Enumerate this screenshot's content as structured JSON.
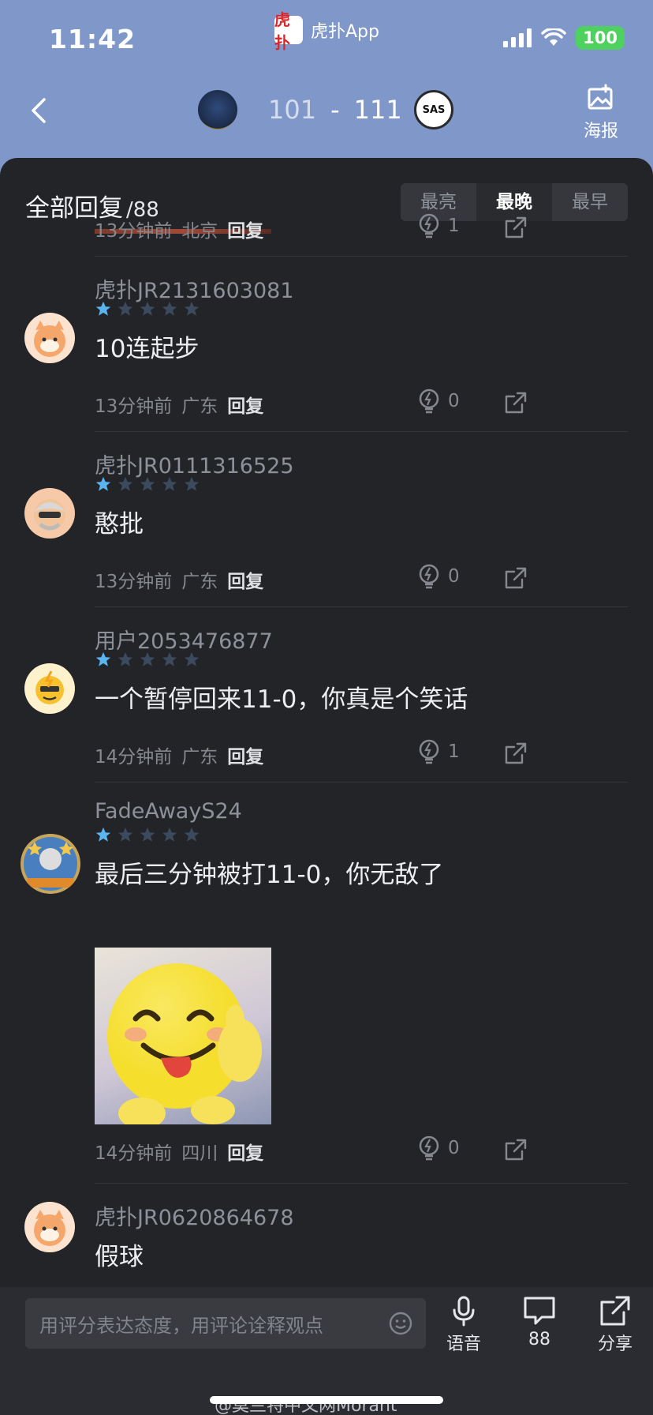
{
  "status_bar": {
    "time": "11:42",
    "app_name": "虎扑App",
    "app_logo_text": "虎扑",
    "battery": "100"
  },
  "game": {
    "home_score": "101",
    "separator": "-",
    "away_score": "111",
    "away_logo_text": "SAS",
    "poster_label": "海报"
  },
  "replies": {
    "title": "全部回复",
    "count": "/88",
    "sort_tabs": [
      "最亮",
      "最晚",
      "最早"
    ],
    "active_sort": "最晚"
  },
  "partial_comment": {
    "time": "13分钟前",
    "location": "北京",
    "reply_label": "回复",
    "lights": "1"
  },
  "comments": [
    {
      "user": "虎扑JR2131603081",
      "rating": 1,
      "content": "10连起步",
      "time": "13分钟前",
      "location": "广东",
      "reply_label": "回复",
      "lights": "0"
    },
    {
      "user": "虎扑JR0111316525",
      "rating": 1,
      "content": "憨批",
      "time": "13分钟前",
      "location": "广东",
      "reply_label": "回复",
      "lights": "0"
    },
    {
      "user": "用户2053476877",
      "rating": 1,
      "content": "一个暂停回来11-0，你真是个笑话",
      "time": "14分钟前",
      "location": "广东",
      "reply_label": "回复",
      "lights": "1"
    },
    {
      "user": "FadeAwayS24",
      "rating": 1,
      "content": "最后三分钟被打11-0，你无敌了",
      "time": "14分钟前",
      "location": "四川",
      "reply_label": "回复",
      "lights": "0",
      "has_image": true
    },
    {
      "user": "虎扑JR0620864678",
      "content": "假球"
    }
  ],
  "bottom_bar": {
    "input_placeholder": "用评分表达态度，用评论诠释观点",
    "voice_label": "语音",
    "comments_count": "88",
    "share_label": "分享",
    "watermark": "@莫兰特中文网Morant"
  },
  "colors": {
    "star_filled": "#5ab4f0",
    "star_empty": "#3b4a5c",
    "header_bg": "#7f98c9",
    "sheet_bg": "#232428"
  }
}
